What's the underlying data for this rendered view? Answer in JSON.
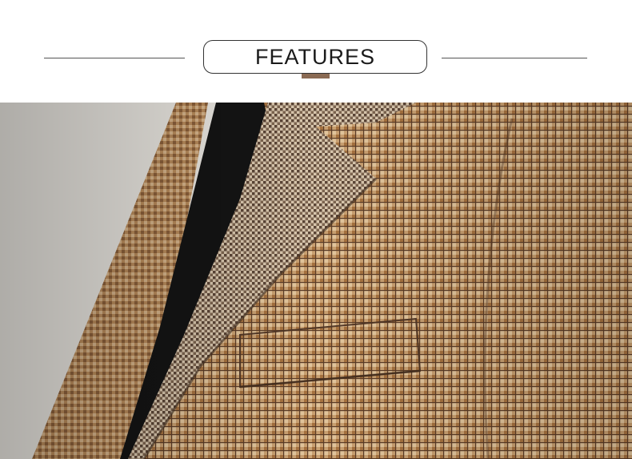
{
  "header": {
    "title": "FEATURES"
  },
  "colors": {
    "accent": "#8a6a53",
    "rule": "#555555",
    "fabric_light": "#d9b58a",
    "fabric_mid": "#a97a4a",
    "fabric_dark": "#4e3424",
    "lapel_dark": "#5b4536",
    "shirt": "#141414",
    "background_wall": "#e9e6e0"
  },
  "photo": {
    "subject": "houndstooth-coat-closeup"
  }
}
